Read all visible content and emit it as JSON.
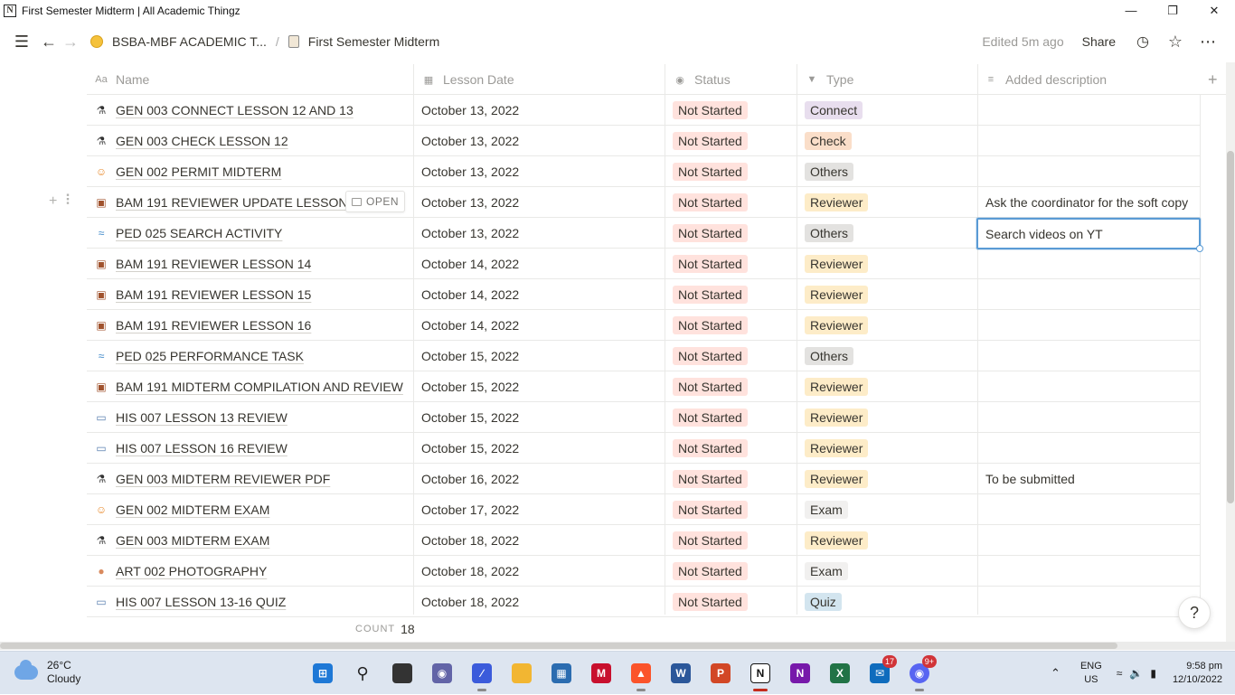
{
  "window": {
    "title": "First Semester Midterm | All Academic Thingz"
  },
  "breadcrumb": {
    "workspace": "BSBA-MBF ACADEMIC T...",
    "page": "First Semester Midterm"
  },
  "topbar": {
    "edited": "Edited 5m ago",
    "share": "Share"
  },
  "columns": {
    "name": "Name",
    "date": "Lesson Date",
    "status": "Status",
    "type": "Type",
    "desc": "Added description"
  },
  "open_label": "OPEN",
  "rows": [
    {
      "icon": "flask-icon",
      "name": "GEN 003 CONNECT LESSON 12 AND 13",
      "date": "October 13, 2022",
      "status": "Not Started",
      "type": "Connect",
      "desc": ""
    },
    {
      "icon": "flask-icon",
      "name": "GEN 003 CHECK LESSON 12",
      "date": "October 13, 2022",
      "status": "Not Started",
      "type": "Check",
      "desc": ""
    },
    {
      "icon": "face-icon",
      "name": "GEN 002 PERMIT MIDTERM",
      "date": "October 13, 2022",
      "status": "Not Started",
      "type": "Others",
      "desc": ""
    },
    {
      "icon": "briefcase-icon",
      "name": "BAM 191 REVIEWER UPDATE LESSON 11",
      "date": "October 13, 2022",
      "status": "Not Started",
      "type": "Reviewer",
      "desc": "Ask the coordinator for the soft copy"
    },
    {
      "icon": "swimmer-icon",
      "name": "PED 025 SEARCH ACTIVITY",
      "date": "October 13, 2022",
      "status": "Not Started",
      "type": "Others",
      "desc": "Search videos on YT"
    },
    {
      "icon": "briefcase-icon",
      "name": "BAM 191 REVIEWER LESSON 14",
      "date": "October 14, 2022",
      "status": "Not Started",
      "type": "Reviewer",
      "desc": ""
    },
    {
      "icon": "briefcase-icon",
      "name": "BAM 191 REVIEWER LESSON 15",
      "date": "October 14, 2022",
      "status": "Not Started",
      "type": "Reviewer",
      "desc": ""
    },
    {
      "icon": "briefcase-icon",
      "name": "BAM 191 REVIEWER LESSON 16",
      "date": "October 14, 2022",
      "status": "Not Started",
      "type": "Reviewer",
      "desc": ""
    },
    {
      "icon": "swimmer-icon",
      "name": "PED 025 PERFORMANCE TASK",
      "date": "October 15, 2022",
      "status": "Not Started",
      "type": "Others",
      "desc": ""
    },
    {
      "icon": "briefcase-icon",
      "name": "BAM 191 MIDTERM COMPILATION AND REVIEW",
      "date": "October 15, 2022",
      "status": "Not Started",
      "type": "Reviewer",
      "desc": ""
    },
    {
      "icon": "book-icon",
      "name": "HIS 007 LESSON 13 REVIEW",
      "date": "October 15, 2022",
      "status": "Not Started",
      "type": "Reviewer",
      "desc": ""
    },
    {
      "icon": "book-icon",
      "name": "HIS 007 LESSON 16 REVIEW",
      "date": "October 15, 2022",
      "status": "Not Started",
      "type": "Reviewer",
      "desc": ""
    },
    {
      "icon": "flask-icon",
      "name": "GEN 003 MIDTERM REVIEWER PDF",
      "date": "October 16, 2022",
      "status": "Not Started",
      "type": "Reviewer",
      "desc": "To be submitted"
    },
    {
      "icon": "face-icon",
      "name": "GEN 002 MIDTERM EXAM",
      "date": "October 17, 2022",
      "status": "Not Started",
      "type": "Exam",
      "desc": ""
    },
    {
      "icon": "flask-icon",
      "name": "GEN 003 MIDTERM EXAM",
      "date": "October 18, 2022",
      "status": "Not Started",
      "type": "Reviewer",
      "desc": ""
    },
    {
      "icon": "palette-icon",
      "name": "ART 002 PHOTOGRAPHY",
      "date": "October 18, 2022",
      "status": "Not Started",
      "type": "Exam",
      "desc": ""
    },
    {
      "icon": "book-icon",
      "name": "HIS 007 LESSON 13-16 QUIZ",
      "date": "October 18, 2022",
      "status": "Not Started",
      "type": "Quiz",
      "desc": ""
    }
  ],
  "type_colors": {
    "Connect": "#e8deee",
    "Check": "#fadec9",
    "Others": "#e3e2e0",
    "Reviewer": "#fdecc8",
    "Exam": "#f1f0ef",
    "Quiz": "#d3e5ef"
  },
  "status_color": "#ffe2dd",
  "count": {
    "label": "COUNT",
    "value": "18"
  },
  "help": "?",
  "taskbar": {
    "temp": "26°C",
    "condition": "Cloudy",
    "lang1": "ENG",
    "lang2": "US",
    "time": "9:58 pm",
    "date": "12/10/2022",
    "badge_mail": "17",
    "badge_discord": "9+"
  }
}
